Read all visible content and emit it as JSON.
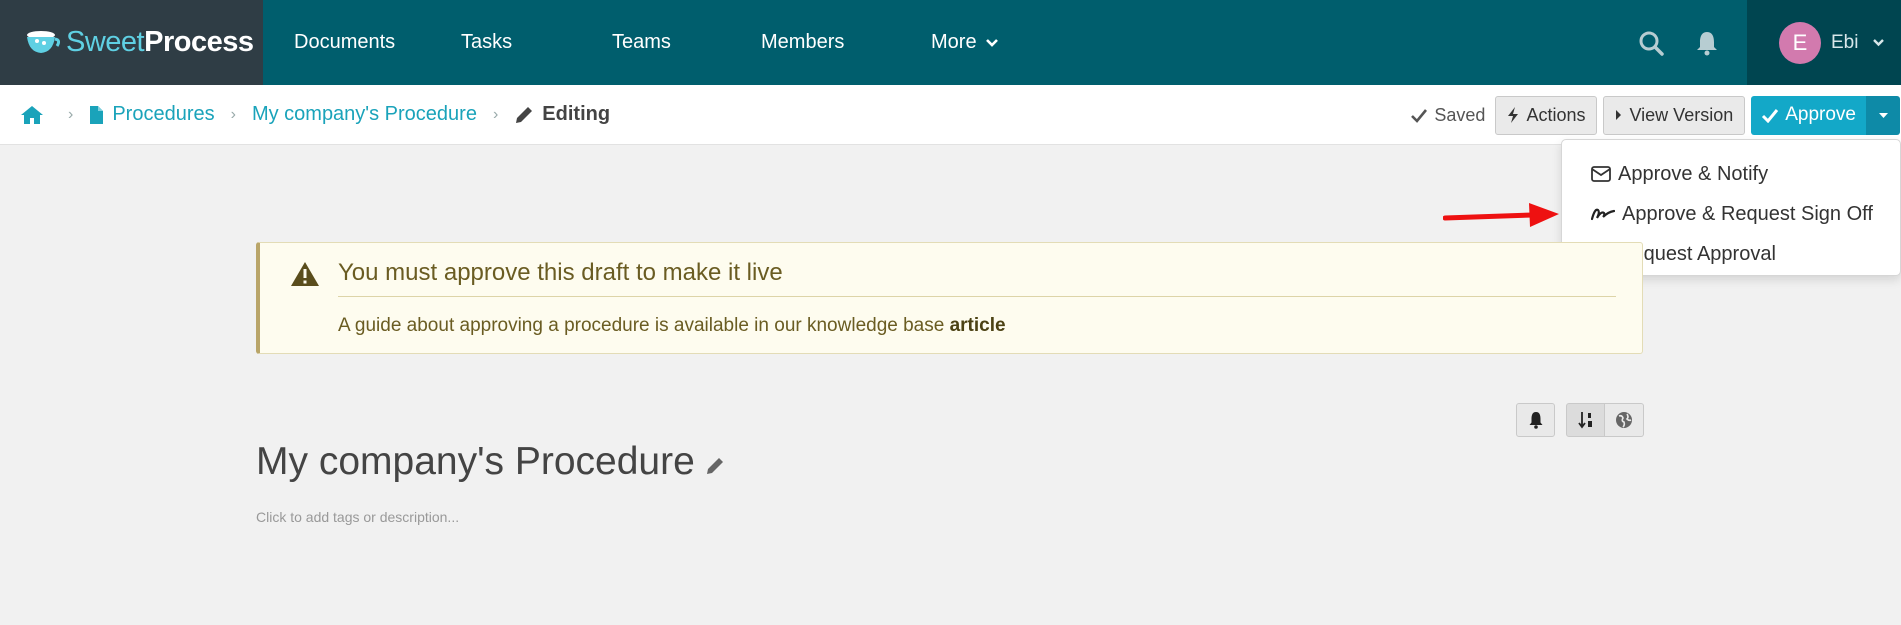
{
  "brand": {
    "sweet": "Sweet",
    "process": "Process",
    "accent": "#5fd0e3"
  },
  "nav": {
    "items": [
      "Documents",
      "Tasks",
      "Teams",
      "Members"
    ],
    "more_label": "More"
  },
  "user": {
    "initial": "E",
    "name": "Ebi",
    "avatar_color": "#d27aae"
  },
  "breadcrumb": {
    "items": [
      "Procedures",
      "My company's Procedure"
    ],
    "current": "Editing"
  },
  "toolbar": {
    "saved_label": "Saved",
    "actions_label": "Actions",
    "view_version_label": "View Version",
    "approve_label": "Approve"
  },
  "approve_menu": {
    "items": [
      "Approve & Notify",
      "Approve & Request Sign Off",
      "Request Approval"
    ]
  },
  "alert": {
    "title": "You must approve this draft to make it live",
    "body": "A guide about approving a procedure is available in our knowledge base ",
    "link": "article"
  },
  "procedure": {
    "title": "My company's Procedure",
    "description_placeholder": "Click to add tags or description..."
  },
  "colors": {
    "nav_bg": "#005e6d",
    "logo_bg": "#2f3d45",
    "link": "#1aa3ba",
    "approve": "#13a8c8",
    "annotation_arrow": "#ee1111"
  }
}
